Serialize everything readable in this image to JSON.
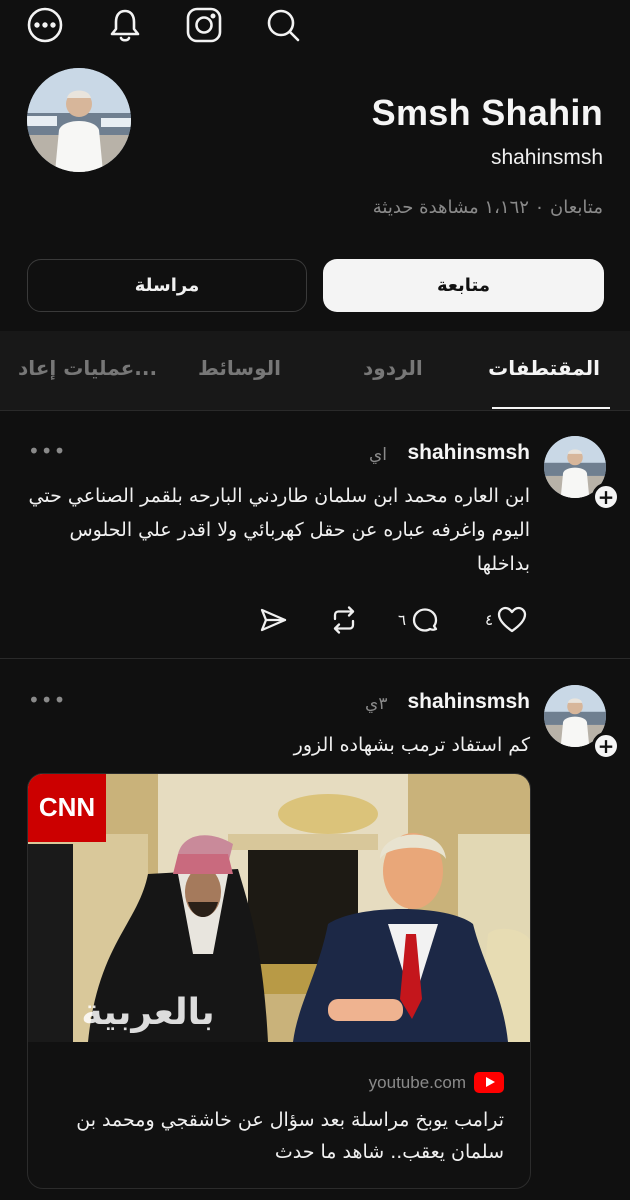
{
  "icons": {
    "more": "more-circle-icon",
    "notifications": "bell-icon",
    "instagram": "instagram-icon",
    "search": "search-icon"
  },
  "profile": {
    "name": "Smsh Shahin",
    "handle": "shahinsmsh",
    "stats": "متابعان ٠ ١،١٦٢ مشاهدة حديثة"
  },
  "buttons": {
    "follow": "متابعة",
    "message": "مراسلة"
  },
  "tabs": [
    {
      "label": "المقتطفات",
      "active": true
    },
    {
      "label": "الردود",
      "active": false
    },
    {
      "label": "الوسائط",
      "active": false
    },
    {
      "label": "عمليات إعاد...",
      "active": false
    }
  ],
  "posts": [
    {
      "user": "shahinsmsh",
      "time": "اي",
      "text": "ابن العاره محمد ابن سلمان طاردني البارحه بلقمر الصناعي حتي اليوم واغرفه عباره عن حقل كهربائي ولا اقدر علي الحلوس بداخلها",
      "likes": "٤",
      "replies": "٦"
    },
    {
      "user": "shahinsmsh",
      "time": "٣ي",
      "text": "كم استفاد ترمب بشهاده الزور",
      "link_card": {
        "source": "youtube.com",
        "title": "ترامب يوبخ مراسلة بعد سؤال عن خاشقجي ومحمد بن سلمان يعقب.. شاهد ما حدث",
        "image_labels": {
          "brand": "CNN",
          "watermark": "بالعربية"
        }
      }
    }
  ],
  "colors": {
    "background": "#101010",
    "text": "#f3f3f3",
    "muted": "#8a8a8a",
    "follow_button": "#f4f4f4",
    "youtube_red": "#ff0000",
    "cnn_red": "#cc0000"
  }
}
